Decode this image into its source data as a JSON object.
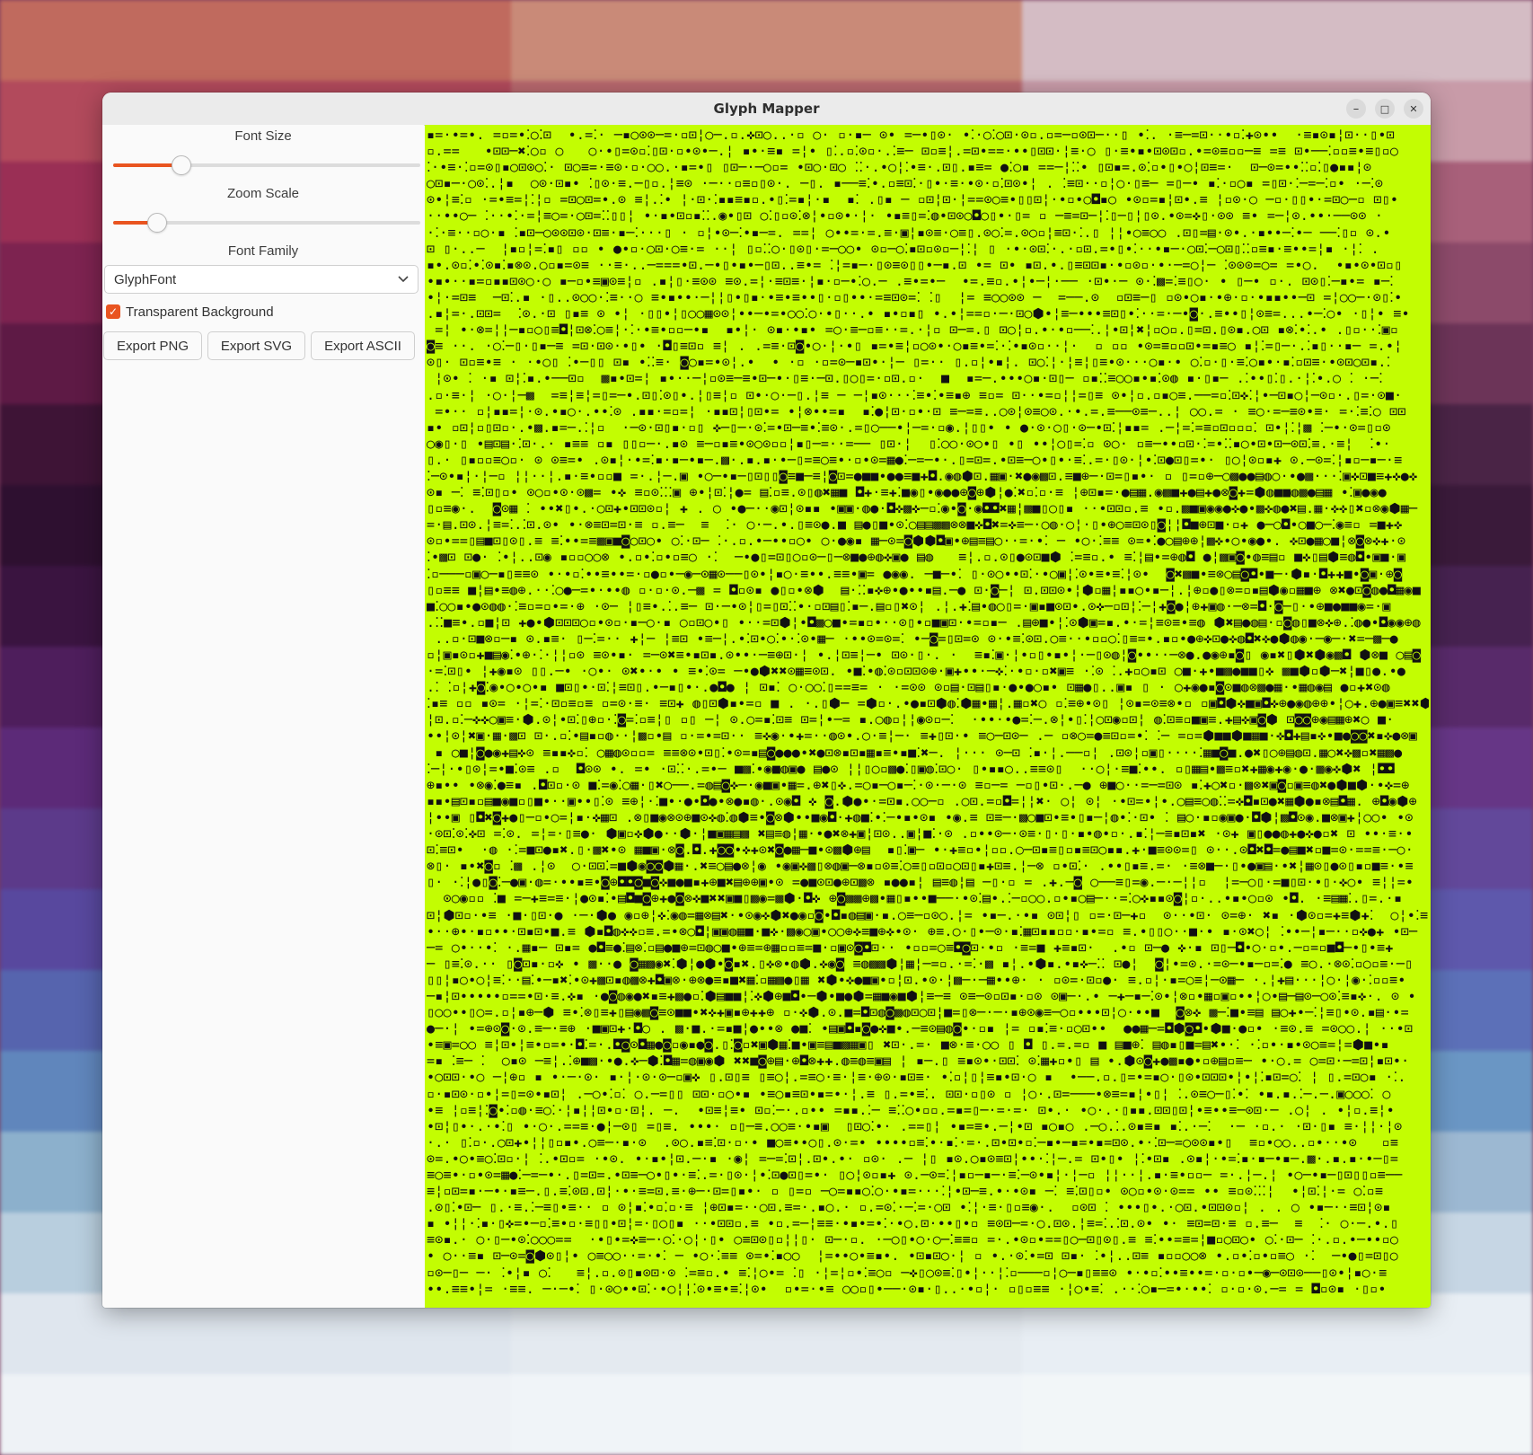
{
  "window": {
    "title": "Glyph Mapper",
    "controls": {
      "minimize": "–",
      "maximize": "□",
      "close": "✕"
    }
  },
  "panel": {
    "font_size": {
      "label": "Font Size",
      "value_fraction": 0.22
    },
    "zoom_scale": {
      "label": "Zoom Scale",
      "value_fraction": 0.14
    },
    "font_family": {
      "label": "Font Family",
      "selected": "GlyphFont",
      "chevron_icon": "chevron-down-icon"
    },
    "transparent_background": {
      "label": "Transparent Background",
      "checked": true
    },
    "buttons": {
      "export_png": "Export PNG",
      "export_svg": "Export SVG",
      "export_ascii": "Export ASCII"
    }
  },
  "canvas": {
    "background": "#c3fd02",
    "ink": "#111111",
    "accent": "#e95420"
  }
}
